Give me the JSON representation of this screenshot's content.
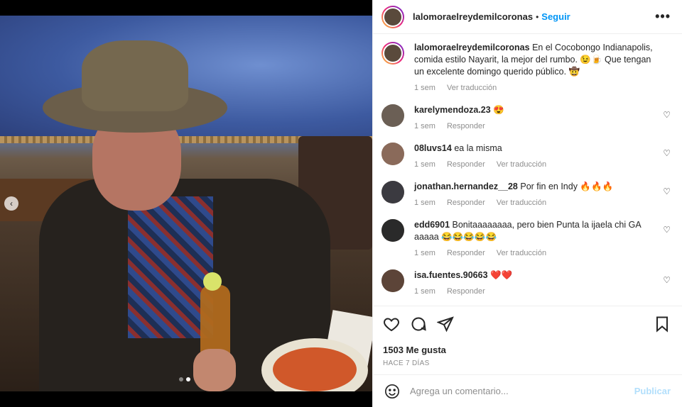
{
  "post": {
    "username": "lalomoraelreydemilcoronas",
    "follow_label": "Seguir",
    "more_icon": "more-horizontal-icon",
    "caption_text": "En el Cocobongo Indianapolis, comida estilo Nayarit, la mejor del rumbo. 😉🍺 Que tengan un excelente domingo querido público. 🤠",
    "caption_time": "1 sem",
    "caption_translate": "Ver traducción"
  },
  "comments": [
    {
      "user": "karelymendoza.23",
      "text": "😍",
      "time": "1 sem",
      "reply": "Responder",
      "translate": ""
    },
    {
      "user": "08luvs14",
      "text": "ea la misma",
      "time": "1 sem",
      "reply": "Responder",
      "translate": "Ver traducción"
    },
    {
      "user": "jonathan.hernandez__28",
      "text": "Por fin en Indy 🔥🔥🔥",
      "time": "1 sem",
      "reply": "Responder",
      "translate": "Ver traducción"
    },
    {
      "user": "edd6901",
      "text": "Bonitaaaaaaaa, pero bien Punta la ijaela chi GA aaaaa 😂😂😂😂😂",
      "time": "1 sem",
      "reply": "Responder",
      "translate": "Ver traducción"
    },
    {
      "user": "isa.fuentes.90663",
      "text": "❤️❤️",
      "time": "1 sem",
      "reply": "Responder",
      "translate": ""
    }
  ],
  "stats": {
    "likes": "1503 Me gusta",
    "ago": "HACE 7 DÍAS"
  },
  "composer": {
    "placeholder": "Agrega un comentario...",
    "publish_label": "Publicar"
  },
  "carousel": {
    "total_slides": 2,
    "active_slide": 2,
    "prev_glyph": "‹"
  }
}
